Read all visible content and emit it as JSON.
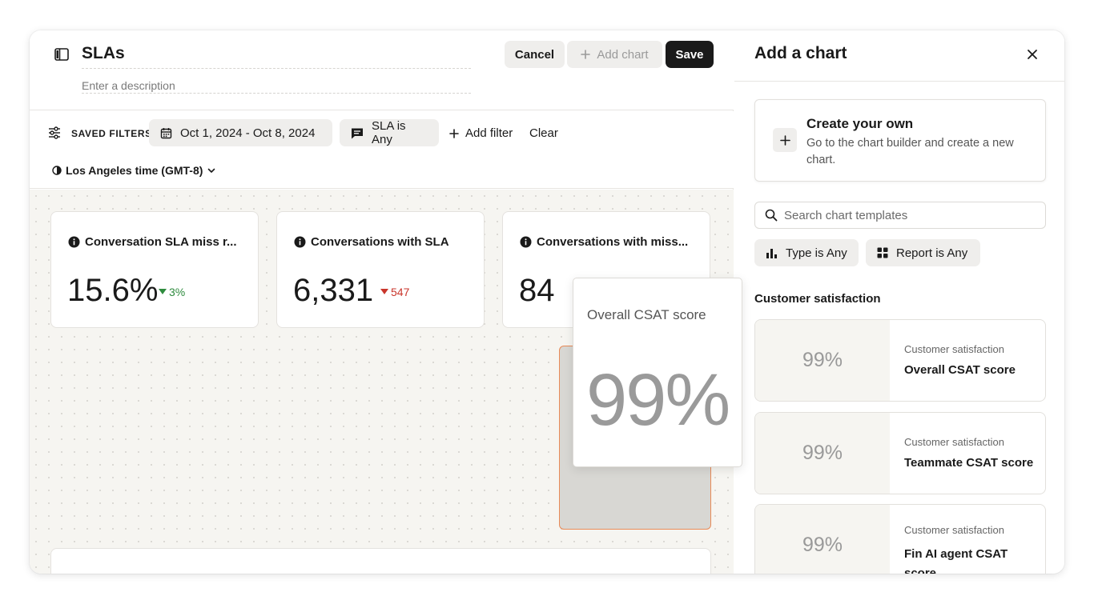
{
  "header": {
    "title": "SLAs",
    "description_placeholder": "Enter a description",
    "cancel_label": "Cancel",
    "add_chart_label": "Add chart",
    "save_label": "Save"
  },
  "filters": {
    "saved_label": "SAVED FILTERS:",
    "date_range": "Oct 1, 2024 - Oct 8, 2024",
    "sla_filter": "SLA is Any",
    "add_filter_label": "Add filter",
    "clear_label": "Clear",
    "timezone": "Los Angeles time (GMT-8)"
  },
  "cards": [
    {
      "title": "Conversation SLA miss r...",
      "value": "15.6%",
      "delta": "3%",
      "delta_direction": "up"
    },
    {
      "title": "Conversations with SLA",
      "value": "6,331",
      "delta": "547",
      "delta_direction": "down"
    },
    {
      "title": "Conversations with miss...",
      "value": "84"
    }
  ],
  "dragging_card": {
    "title": "Overall CSAT score",
    "value": "99%"
  },
  "panel": {
    "title": "Add a chart",
    "create": {
      "title": "Create your own",
      "description": "Go to the chart builder and create a new chart."
    },
    "search_placeholder": "Search chart templates",
    "type_filter": "Type is Any",
    "report_filter": "Report is Any",
    "section_title": "Customer satisfaction",
    "templates": [
      {
        "preview": "99%",
        "category": "Customer satisfaction",
        "name": "Overall CSAT score"
      },
      {
        "preview": "99%",
        "category": "Customer satisfaction",
        "name": "Teammate CSAT score"
      },
      {
        "preview": "99%",
        "category": "Customer satisfaction",
        "name": "Fin AI agent CSAT score"
      }
    ]
  },
  "colors": {
    "primary_button": "#1a1a1a",
    "delta_up": "#2e8b3e",
    "delta_down": "#c9352b",
    "drop_zone_border": "#e88a57"
  }
}
